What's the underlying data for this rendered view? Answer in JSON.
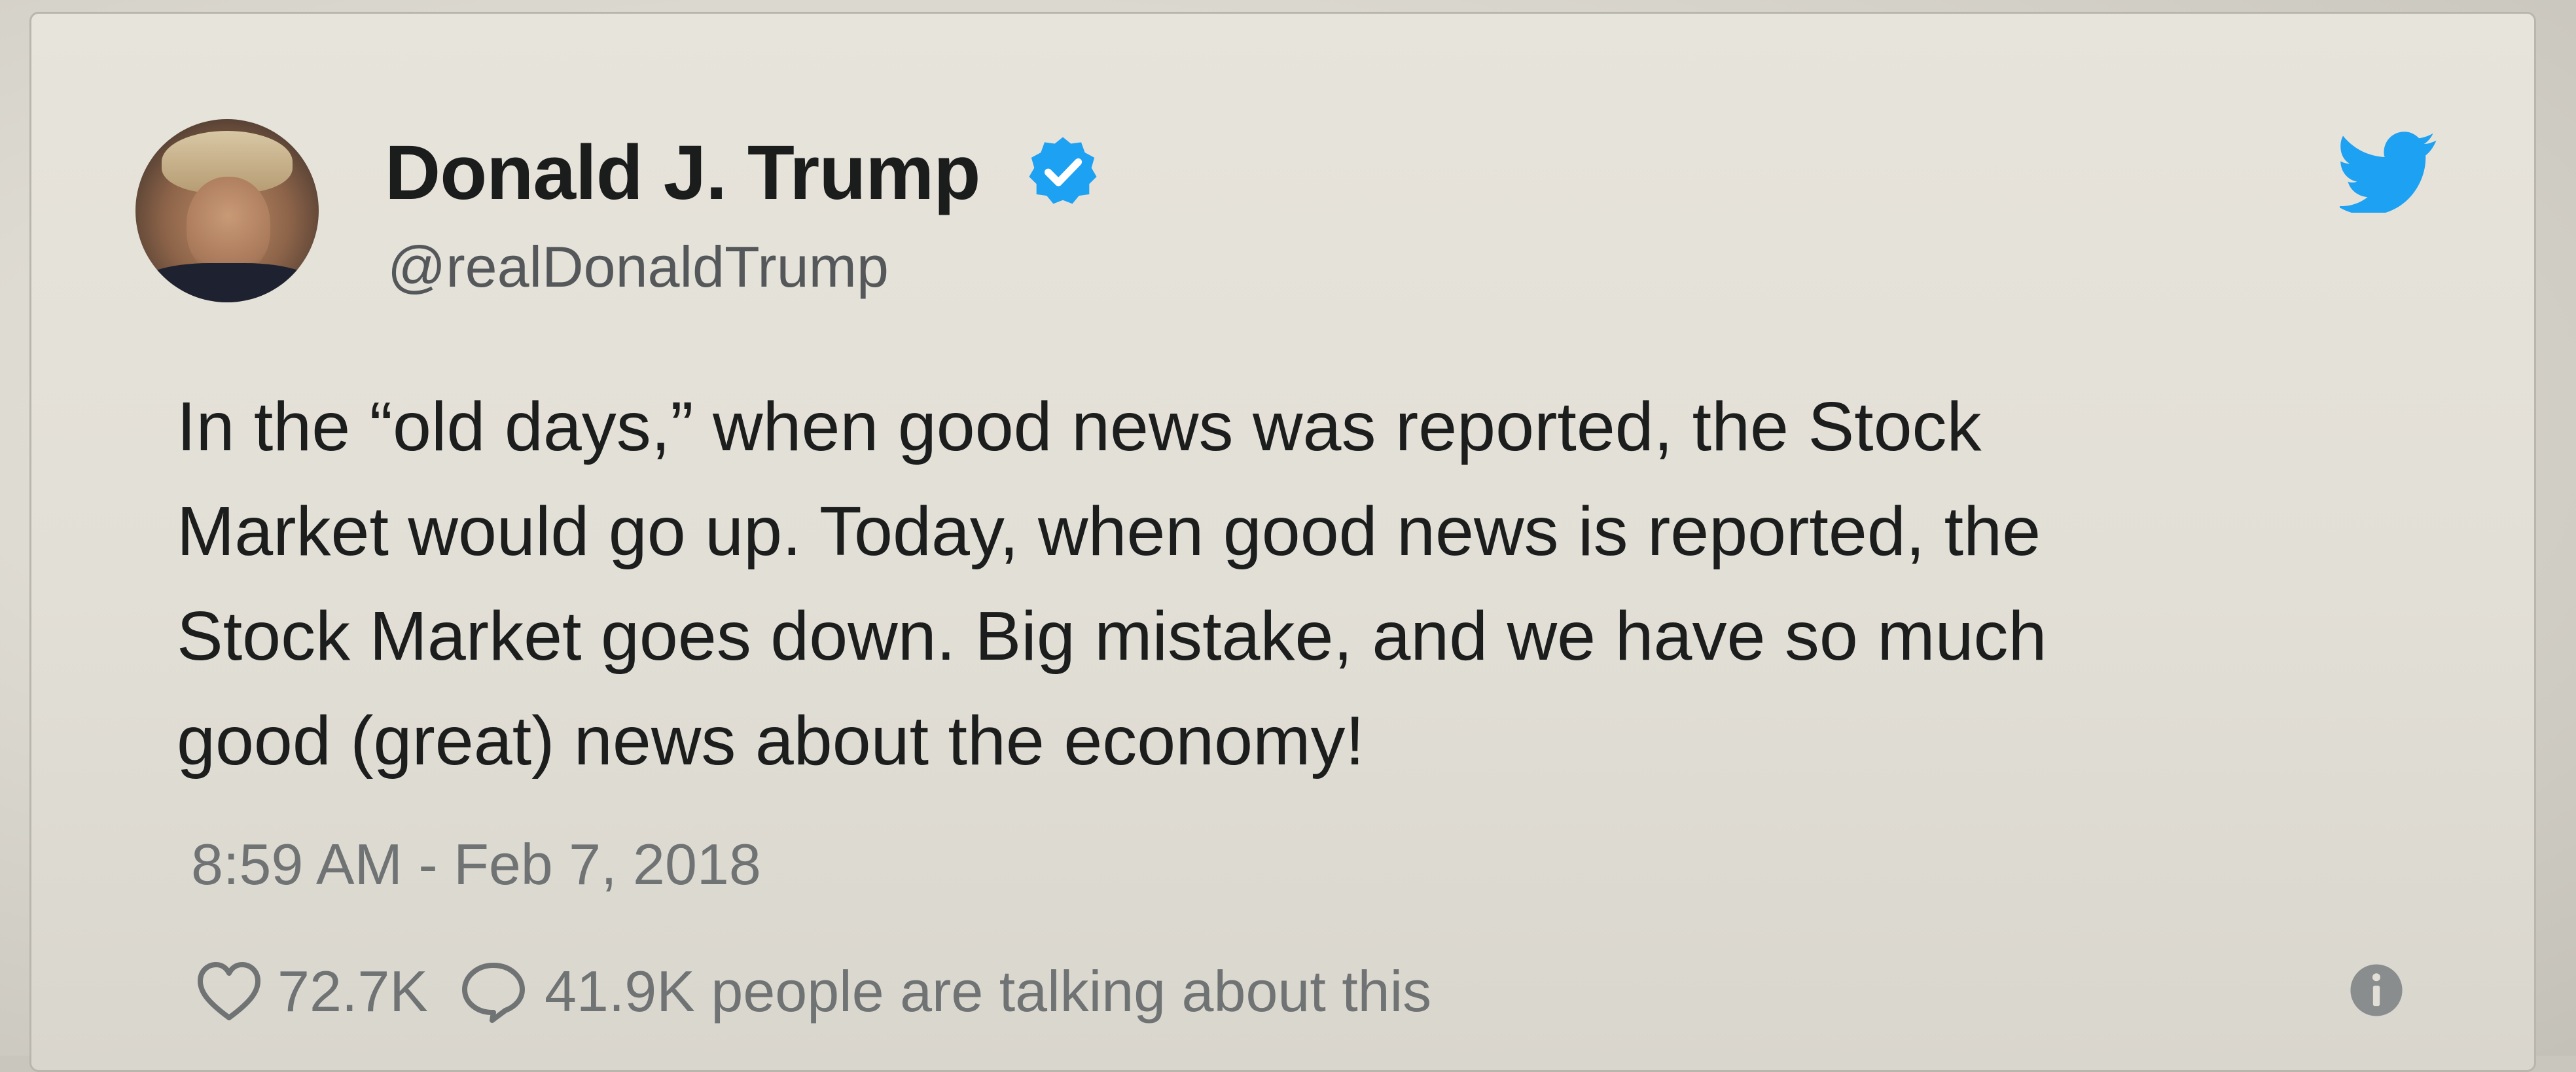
{
  "tweet": {
    "display_name": "Donald J. Trump",
    "handle": "@realDonaldTrump",
    "verified_icon": "verified-badge-icon",
    "brand_icon": "twitter-bird-icon",
    "text": "In the “old days,” when good news was reported, the Stock\nMarket would go up. Today, when good news is reported, the\nStock Market goes down. Big mistake, and we have so much\ngood (great) news about the economy!",
    "timestamp": "8:59 AM - Feb 7, 2018",
    "likes": "72.7K",
    "conversation": "41.9K people are talking about this",
    "like_icon": "heart-icon",
    "reply_icon": "reply-bubble-icon",
    "info_icon": "info-icon"
  },
  "colors": {
    "accent": "#1da1f2",
    "text": "#1c1d1d",
    "secondary_text": "#707374",
    "background": "#e4e1d8"
  }
}
